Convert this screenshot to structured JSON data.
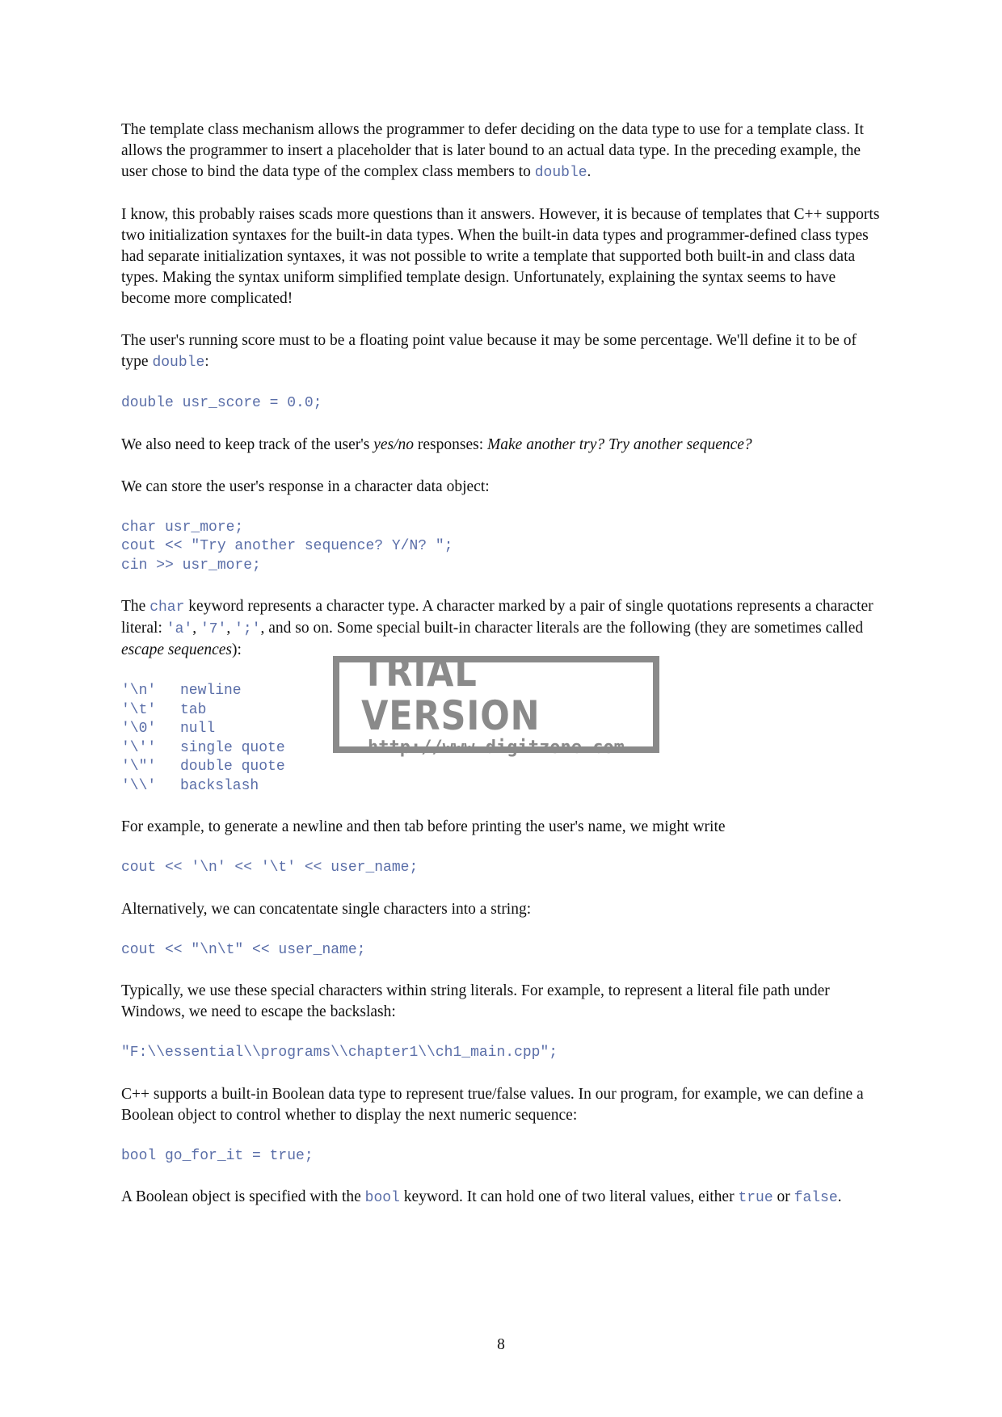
{
  "para1": {
    "text": "The template class mechanism allows the programmer to defer deciding on the data type to use for a template class. It allows the programmer to insert a placeholder that is later bound to an actual data type. In the preceding example, the user chose to bind the data type of the complex class members to ",
    "code": "double",
    "end": "."
  },
  "para2": "I know, this probably raises scads more questions than it answers. However, it is because of templates that C++ supports two initialization syntaxes for the built-in data types. When the built-in data types and programmer-defined class types had separate initialization syntaxes, it was not possible to write a template that supported both built-in and class data types. Making the syntax uniform simplified template design. Unfortunately, explaining the syntax seems to have become more complicated!",
  "para3": {
    "text": "The user's running score must to be a floating point value because it may be some percentage. We'll define it to be of type ",
    "code": "double",
    "end": ":"
  },
  "code1": "double usr_score = 0.0;",
  "para4": {
    "a": "We also need to keep track of the user's ",
    "em1": "yes/no",
    "b": " responses: ",
    "em2": "Make another try? Try another sequence?"
  },
  "para5": "We can store the user's response in a character data object:",
  "code2": "char usr_more;\ncout << \"Try another sequence? Y/N? \";\ncin >> usr_more;",
  "para6": {
    "a": "The ",
    "code1": "char",
    "b": " keyword represents a character type. A character marked by a pair of single quotations represents a character literal: ",
    "code2": "'a'",
    "c": ", ",
    "code3": "'7'",
    "d": ", ",
    "code4": "';'",
    "e": ", and so on. Some special built-in character literals are the following (they are sometimes called ",
    "em": "escape sequences",
    "f": "):"
  },
  "escapes": [
    {
      "code": "'\\n'",
      "desc": "newline"
    },
    {
      "code": "'\\t'",
      "desc": "tab"
    },
    {
      "code": "'\\0'",
      "desc": "null"
    },
    {
      "code": "'\\''",
      "desc": "single quote"
    },
    {
      "code": "'\\\"'",
      "desc": "double quote"
    },
    {
      "code": "'\\\\'",
      "desc": "backslash"
    }
  ],
  "para7": "For example, to generate a newline and then tab before printing the user's name, we might write",
  "code3": "cout << '\\n' << '\\t' << user_name;",
  "para8": "Alternatively, we can concatentate single characters into a string:",
  "code4": "cout << \"\\n\\t\" << user_name;",
  "para9": "Typically, we use these special characters within string literals. For example, to represent a literal file path under Windows, we need to escape the backslash:",
  "code5": "\"F:\\\\essential\\\\programs\\\\chapter1\\\\ch1_main.cpp\";",
  "para10": "C++ supports a built-in Boolean data type to represent true/false values. In our program, for example, we can define a Boolean object to control whether to display the next numeric sequence:",
  "code6": "bool go_for_it = true;",
  "para11": {
    "a": "A Boolean object is specified with the ",
    "code1": "bool",
    "b": " keyword. It can hold one of two literal values, either ",
    "code2": "true",
    "c": " or ",
    "code3": "false",
    "d": "."
  },
  "page_number": "8",
  "watermark": {
    "title": "TRIAL VERSION",
    "url": "http://www.digitzone.com"
  },
  "colors": {
    "code": "#5a6ea8",
    "text": "#111111",
    "watermark": "#8a8a8a"
  }
}
